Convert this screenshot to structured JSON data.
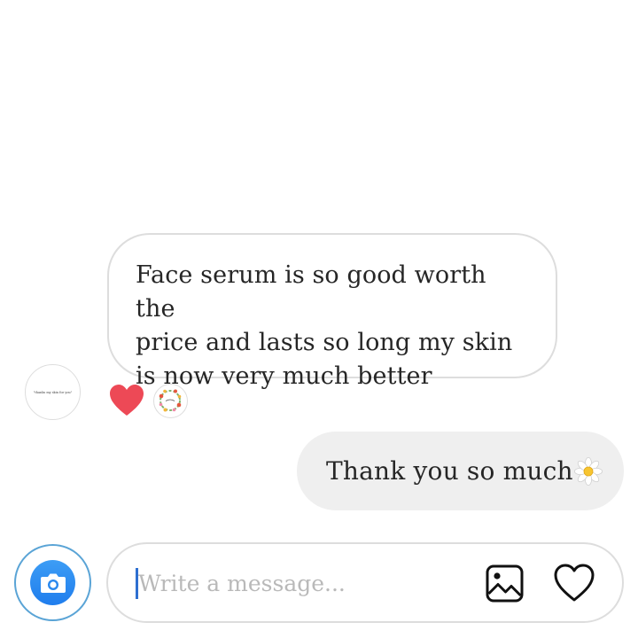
{
  "conversation": {
    "incoming_message": {
      "text": "Face serum is so good worth the price and lasts so long my skin is now very much better",
      "lines": [
        "Face serum is so good worth the",
        "price and lasts so long my skin",
        "is now very much better"
      ],
      "avatar_caption": "\"thanks my skin for you\"",
      "reactions": [
        "red-heart-icon",
        "flower-wreath-sticker-icon"
      ]
    },
    "outgoing_message": {
      "text": "Thank you so much",
      "emoji": "daisy-icon"
    }
  },
  "composer": {
    "placeholder": "Write a message...",
    "value": "",
    "camera_icon": "camera-icon",
    "gallery_icon": "image-gallery-icon",
    "like_icon": "heart-outline-icon"
  },
  "colors": {
    "reaction_heart": "#ed4956",
    "camera_button": "#1f7ded",
    "caret": "#2e6fd0",
    "outgoing_bubble": "#efefef",
    "bubble_border": "#dddddd"
  }
}
